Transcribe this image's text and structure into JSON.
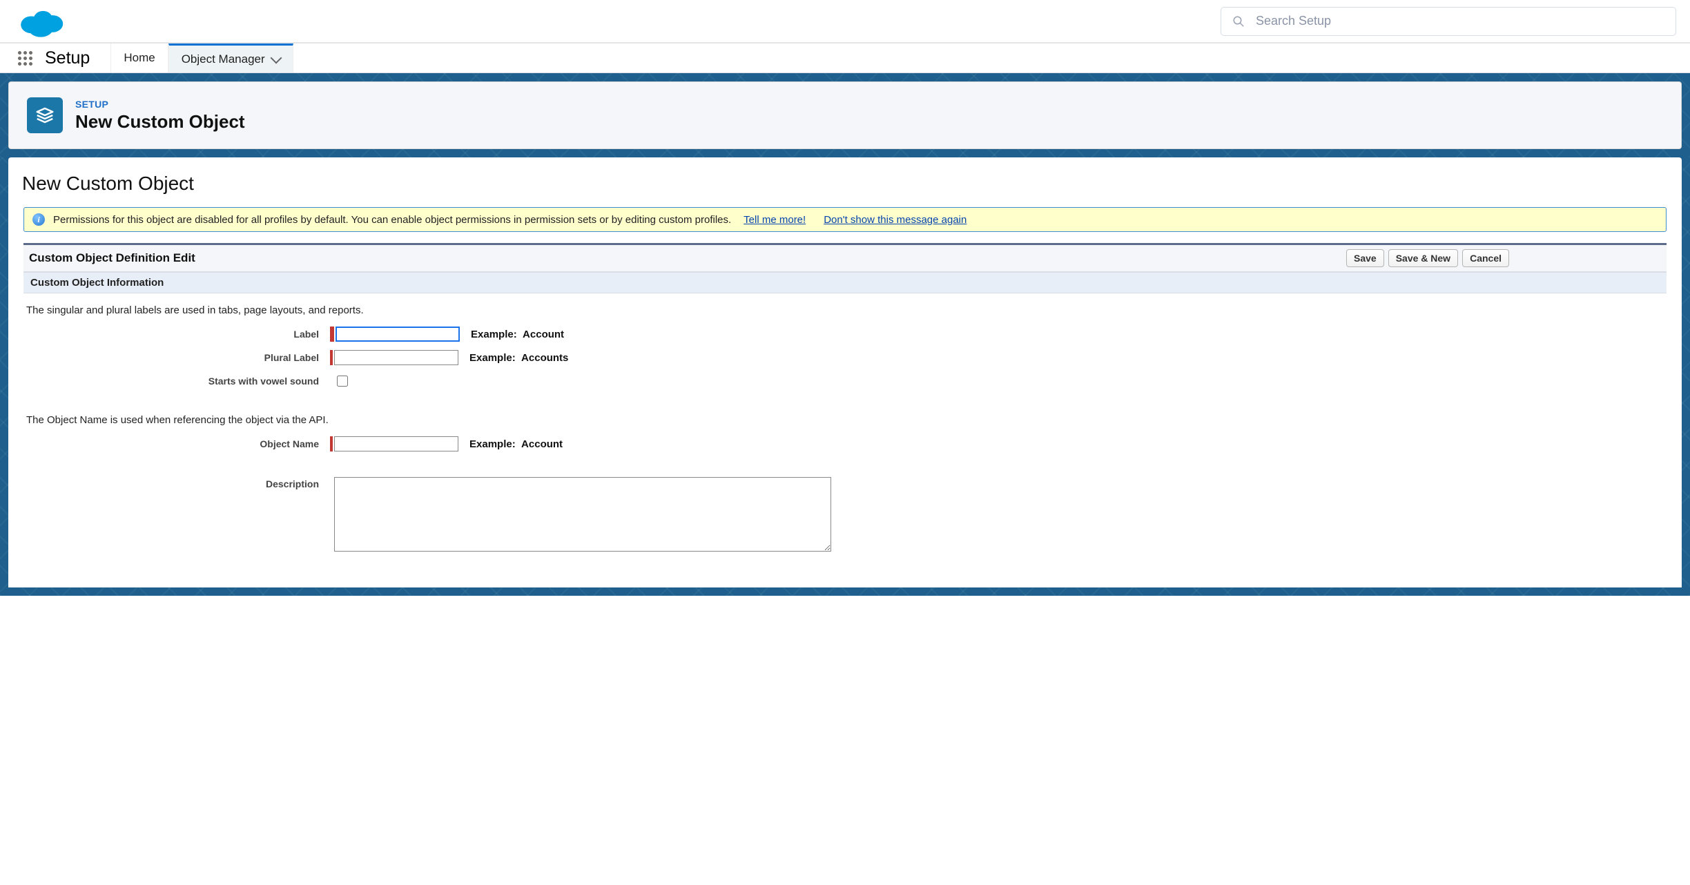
{
  "header": {
    "search_placeholder": "Search Setup"
  },
  "nav": {
    "app_name": "Setup",
    "tabs": [
      {
        "label": "Home"
      },
      {
        "label": "Object Manager"
      }
    ]
  },
  "page_header": {
    "eyebrow": "SETUP",
    "title": "New Custom Object"
  },
  "content": {
    "inner_title": "New Custom Object",
    "banner": {
      "text": "Permissions for this object are disabled for all profiles by default. You can enable object permissions in permission sets or by editing custom profiles.",
      "link_more": "Tell me more!",
      "link_dismiss": "Don't show this message again"
    },
    "section_title": "Custom Object Definition Edit",
    "buttons": {
      "save": "Save",
      "save_new": "Save & New",
      "cancel": "Cancel"
    },
    "subsection_title": "Custom Object Information",
    "helper1": "The singular and plural labels are used in tabs, page layouts, and reports.",
    "helper2": "The Object Name is used when referencing the object via the API.",
    "fields": {
      "label": {
        "label": "Label",
        "value": "",
        "example_prefix": "Example:",
        "example": "Account"
      },
      "plural_label": {
        "label": "Plural Label",
        "value": "",
        "example_prefix": "Example:",
        "example": "Accounts"
      },
      "vowel": {
        "label": "Starts with vowel sound",
        "checked": false
      },
      "object_name": {
        "label": "Object Name",
        "value": "",
        "example_prefix": "Example:",
        "example": "Account"
      },
      "description": {
        "label": "Description",
        "value": ""
      }
    }
  }
}
